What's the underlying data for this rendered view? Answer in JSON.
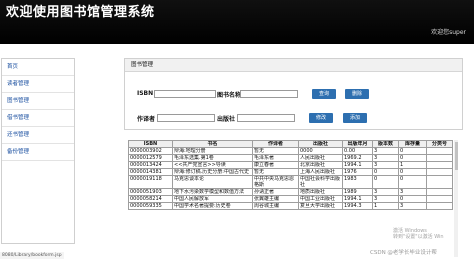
{
  "header": {
    "title": "欢迎使用图书馆管理系统",
    "welcome": "欢迎您super"
  },
  "sidebar": {
    "items": [
      {
        "label": "首页"
      },
      {
        "label": "读者管理"
      },
      {
        "label": "图书管理"
      },
      {
        "label": "借书管理"
      },
      {
        "label": "还书管理"
      },
      {
        "label": "备份管理"
      }
    ]
  },
  "panel": {
    "title": "图书管理",
    "isbn_label": "ISBN",
    "isbn_value": "",
    "bookname_label": "图书名称",
    "bookname_value": "",
    "query_button": "查询",
    "delete_button": "删除",
    "author_label": "作译者",
    "author_value": "",
    "publisher_label": "出版社",
    "publisher_value": "",
    "modify_button": "修改",
    "add_button": "添加"
  },
  "table": {
    "columns": [
      "ISBN",
      "书名",
      "作译者",
      "出版社",
      "出版年月",
      "版本数",
      "库存量",
      "分类号"
    ],
    "rows": [
      [
        "0000003902",
        "辩海:地理分册",
        "暂无",
        "0000",
        "0.00",
        "3",
        "0",
        ""
      ],
      [
        "0000012579",
        "毛泽东选集.第1卷",
        "毛泽东著",
        "人民出版社",
        "1969.2",
        "3",
        "0",
        ""
      ],
      [
        "0000013424",
        "<<共产党宣言>>导读",
        "康立春著",
        "北京出版社",
        "1994.1",
        "3",
        "1",
        ""
      ],
      [
        "0000014381",
        "辩海:修订稿.历史分册:中国古代史",
        "暂无",
        "上海人民出版社",
        "1976",
        "0",
        "0",
        ""
      ],
      [
        "0000019118",
        "马克思谈本论",
        "中共中央马克思恩格斯",
        "中国社会科学出版社",
        "1983",
        "0",
        "0",
        ""
      ],
      [
        "0000051903",
        "地下水污染数学模型和数值方法",
        "孙讷正著",
        "地质出版社",
        "1989",
        "3",
        "3",
        ""
      ],
      [
        "0000058214",
        "中国人民解放军",
        "张翼雄主编",
        "中国工业出版社",
        "1994.1",
        "3",
        "0",
        ""
      ],
      [
        "0000059335",
        "中国学术名著提要:历史卷",
        "周谷城主编",
        "复旦大学出版社",
        "1994.3",
        "1",
        "3",
        ""
      ]
    ]
  },
  "status_bar": {
    "url": "8080/Library/bookform.jsp"
  },
  "watermarks": {
    "windows_line1": "激活 Windows",
    "windows_line2": "转到\"设置\"以激活 Win",
    "csdn": "CSDN @老学长毕业设计帮"
  }
}
